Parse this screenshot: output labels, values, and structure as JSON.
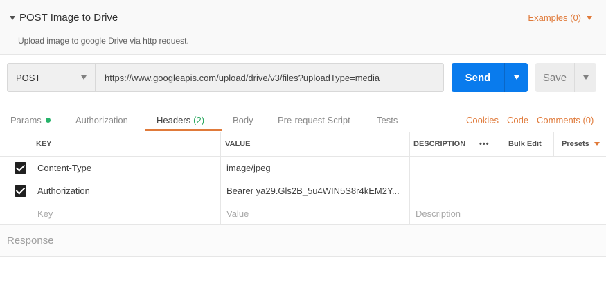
{
  "request": {
    "title": "POST Image to Drive",
    "description": "Upload image to google Drive via http request.",
    "examples_label": "Examples (0)"
  },
  "url_bar": {
    "method": "POST",
    "url": "https://www.googleapis.com/upload/drive/v3/files?uploadType=media",
    "send_label": "Send",
    "save_label": "Save"
  },
  "tabs": {
    "params": "Params",
    "authorization": "Authorization",
    "headers": "Headers",
    "headers_count": "(2)",
    "body": "Body",
    "pre_request": "Pre-request Script",
    "tests": "Tests",
    "cookies": "Cookies",
    "code": "Code",
    "comments": "Comments (0)"
  },
  "headers_table": {
    "columns": {
      "key": "KEY",
      "value": "VALUE",
      "description": "DESCRIPTION"
    },
    "more_label": "•••",
    "bulk_edit": "Bulk Edit",
    "presets": "Presets",
    "rows": [
      {
        "key": "Content-Type",
        "value": "image/jpeg",
        "description": ""
      },
      {
        "key": "Authorization",
        "value": "Bearer ya29.Gls2B_5u4WIN5S8r4kEM2Y...",
        "description": ""
      }
    ],
    "placeholder": {
      "key": "Key",
      "value": "Value",
      "description": "Description"
    }
  },
  "response": {
    "label": "Response"
  },
  "colors": {
    "accent": "#e07a3a",
    "send": "#097bed",
    "status_dot": "#26b36a"
  }
}
